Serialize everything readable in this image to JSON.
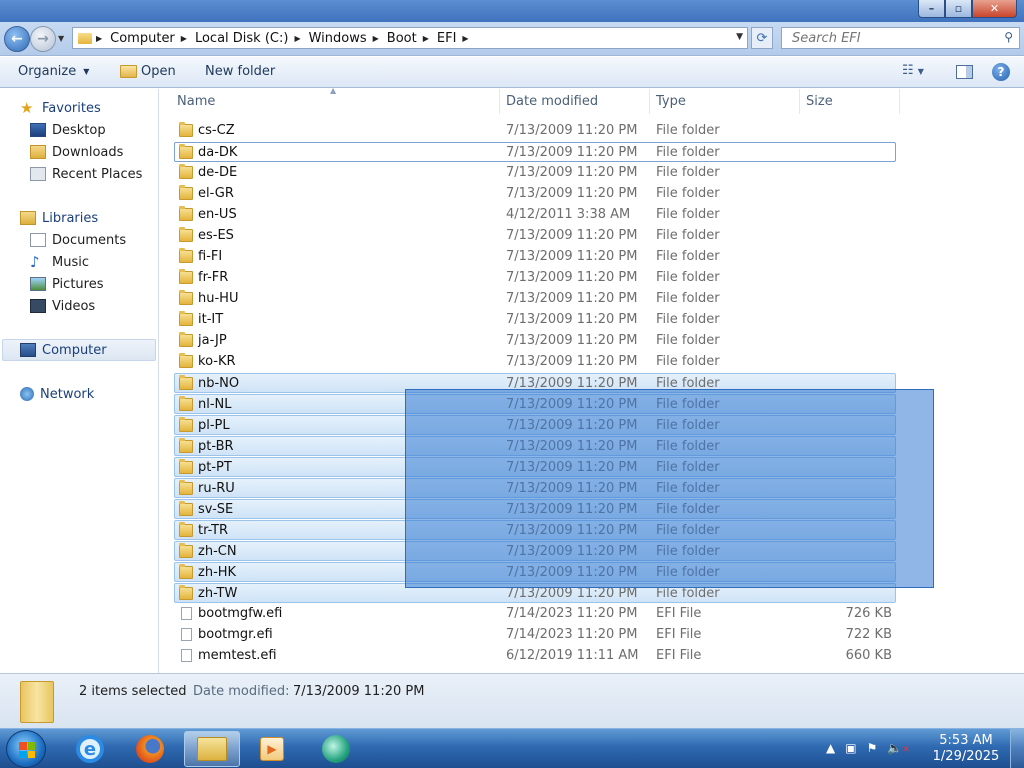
{
  "window": {
    "controls": {
      "minimize": "–",
      "maximize": "▫",
      "close": "✕"
    }
  },
  "address": {
    "breadcrumbs": [
      "Computer",
      "Local Disk (C:)",
      "Windows",
      "Boot",
      "EFI"
    ],
    "search_placeholder": "Search EFI"
  },
  "toolbar": {
    "organize": "Organize",
    "open": "Open",
    "new_folder": "New folder"
  },
  "sidebar": {
    "favorites": {
      "label": "Favorites",
      "items": [
        "Desktop",
        "Downloads",
        "Recent Places"
      ]
    },
    "libraries": {
      "label": "Libraries",
      "items": [
        "Documents",
        "Music",
        "Pictures",
        "Videos"
      ]
    },
    "computer": "Computer",
    "network": "Network"
  },
  "columns": {
    "name": "Name",
    "date": "Date modified",
    "type": "Type",
    "size": "Size"
  },
  "files": [
    {
      "name": "cs-CZ",
      "date": "7/13/2009 11:20 PM",
      "type": "File folder",
      "size": "",
      "kind": "folder",
      "state": "normal"
    },
    {
      "name": "da-DK",
      "date": "7/13/2009 11:20 PM",
      "type": "File folder",
      "size": "",
      "kind": "folder",
      "state": "focus"
    },
    {
      "name": "de-DE",
      "date": "7/13/2009 11:20 PM",
      "type": "File folder",
      "size": "",
      "kind": "folder",
      "state": "normal"
    },
    {
      "name": "el-GR",
      "date": "7/13/2009 11:20 PM",
      "type": "File folder",
      "size": "",
      "kind": "folder",
      "state": "normal"
    },
    {
      "name": "en-US",
      "date": "4/12/2011 3:38 AM",
      "type": "File folder",
      "size": "",
      "kind": "folder",
      "state": "normal"
    },
    {
      "name": "es-ES",
      "date": "7/13/2009 11:20 PM",
      "type": "File folder",
      "size": "",
      "kind": "folder",
      "state": "normal"
    },
    {
      "name": "fi-FI",
      "date": "7/13/2009 11:20 PM",
      "type": "File folder",
      "size": "",
      "kind": "folder",
      "state": "normal"
    },
    {
      "name": "fr-FR",
      "date": "7/13/2009 11:20 PM",
      "type": "File folder",
      "size": "",
      "kind": "folder",
      "state": "normal"
    },
    {
      "name": "hu-HU",
      "date": "7/13/2009 11:20 PM",
      "type": "File folder",
      "size": "",
      "kind": "folder",
      "state": "normal"
    },
    {
      "name": "it-IT",
      "date": "7/13/2009 11:20 PM",
      "type": "File folder",
      "size": "",
      "kind": "folder",
      "state": "normal"
    },
    {
      "name": "ja-JP",
      "date": "7/13/2009 11:20 PM",
      "type": "File folder",
      "size": "",
      "kind": "folder",
      "state": "normal"
    },
    {
      "name": "ko-KR",
      "date": "7/13/2009 11:20 PM",
      "type": "File folder",
      "size": "",
      "kind": "folder",
      "state": "normal"
    },
    {
      "name": "nb-NO",
      "date": "7/13/2009 11:20 PM",
      "type": "File folder",
      "size": "",
      "kind": "folder",
      "state": "selected"
    },
    {
      "name": "nl-NL",
      "date": "7/13/2009 11:20 PM",
      "type": "File folder",
      "size": "",
      "kind": "folder",
      "state": "selected"
    },
    {
      "name": "pl-PL",
      "date": "7/13/2009 11:20 PM",
      "type": "File folder",
      "size": "",
      "kind": "folder",
      "state": "selected"
    },
    {
      "name": "pt-BR",
      "date": "7/13/2009 11:20 PM",
      "type": "File folder",
      "size": "",
      "kind": "folder",
      "state": "selected"
    },
    {
      "name": "pt-PT",
      "date": "7/13/2009 11:20 PM",
      "type": "File folder",
      "size": "",
      "kind": "folder",
      "state": "selected"
    },
    {
      "name": "ru-RU",
      "date": "7/13/2009 11:20 PM",
      "type": "File folder",
      "size": "",
      "kind": "folder",
      "state": "selected"
    },
    {
      "name": "sv-SE",
      "date": "7/13/2009 11:20 PM",
      "type": "File folder",
      "size": "",
      "kind": "folder",
      "state": "selected"
    },
    {
      "name": "tr-TR",
      "date": "7/13/2009 11:20 PM",
      "type": "File folder",
      "size": "",
      "kind": "folder",
      "state": "selected"
    },
    {
      "name": "zh-CN",
      "date": "7/13/2009 11:20 PM",
      "type": "File folder",
      "size": "",
      "kind": "folder",
      "state": "selected"
    },
    {
      "name": "zh-HK",
      "date": "7/13/2009 11:20 PM",
      "type": "File folder",
      "size": "",
      "kind": "folder",
      "state": "selected"
    },
    {
      "name": "zh-TW",
      "date": "7/13/2009 11:20 PM",
      "type": "File folder",
      "size": "",
      "kind": "folder",
      "state": "selected"
    },
    {
      "name": "bootmgfw.efi",
      "date": "7/14/2023 11:20 PM",
      "type": "EFI File",
      "size": "726 KB",
      "kind": "file",
      "state": "normal"
    },
    {
      "name": "bootmgr.efi",
      "date": "7/14/2023 11:20 PM",
      "type": "EFI File",
      "size": "722 KB",
      "kind": "file",
      "state": "normal"
    },
    {
      "name": "memtest.efi",
      "date": "6/12/2019 11:11 AM",
      "type": "EFI File",
      "size": "660 KB",
      "kind": "file",
      "state": "normal"
    }
  ],
  "details": {
    "count": "2 items selected",
    "date_label": "Date modified:",
    "date_value": "7/13/2009 11:20 PM"
  },
  "taskbar": {
    "apps": [
      "internet-explorer-icon",
      "firefox-icon",
      "windows-explorer-icon",
      "media-player-icon",
      "windows-media-center-icon"
    ],
    "clock_time": "5:53 AM",
    "clock_date": "1/29/2025"
  }
}
